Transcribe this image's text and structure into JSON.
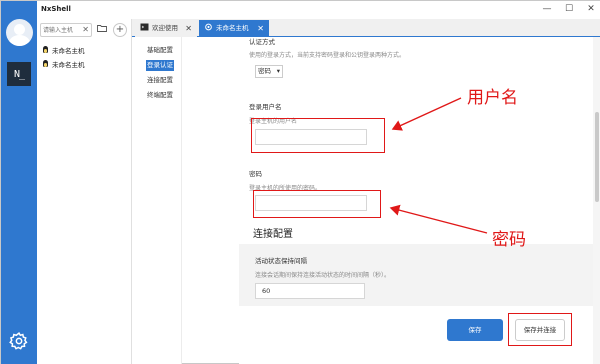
{
  "window": {
    "title": "NxShell",
    "min_glyph": "—",
    "max_glyph": "☐",
    "close_glyph": "✕"
  },
  "rail": {
    "logo_text": "N_"
  },
  "hosts": {
    "search_placeholder": "请输入主机",
    "items": [
      {
        "label": "未命名主机"
      },
      {
        "label": "未命名主机"
      }
    ]
  },
  "tabs": [
    {
      "label": "欢迎使用",
      "close": "✕"
    },
    {
      "label": "未命名主机",
      "close": "✕"
    }
  ],
  "nav": {
    "items": [
      {
        "label": "基础配置",
        "selected": false
      },
      {
        "label": "登录认证",
        "selected": true
      },
      {
        "label": "连接配置",
        "selected": false
      },
      {
        "label": "终端配置",
        "selected": false
      }
    ]
  },
  "auth": {
    "method_label": "认证方式",
    "method_desc": "使用的登录方式，当前支持密码登录和公钥登录两种方式。",
    "method_value": "密码",
    "username_label": "登录用户名",
    "username_desc": "登录主机的用户名",
    "username_value": "",
    "password_label": "密码",
    "password_desc": "登录主机的所使用的密码。",
    "password_value": ""
  },
  "connection": {
    "group_title": "连接配置",
    "keepalive_label": "活动状态保持间隔",
    "keepalive_desc": "连接会话期间保持连接活动状态的时间间隔（秒）。",
    "keepalive_value": "60"
  },
  "buttons": {
    "save": "保存",
    "save_connect": "保存并连接"
  },
  "annotations": {
    "username": "用户名",
    "password": "密码",
    "color": "#e01818"
  },
  "colors": {
    "accent": "#2f78cf"
  }
}
